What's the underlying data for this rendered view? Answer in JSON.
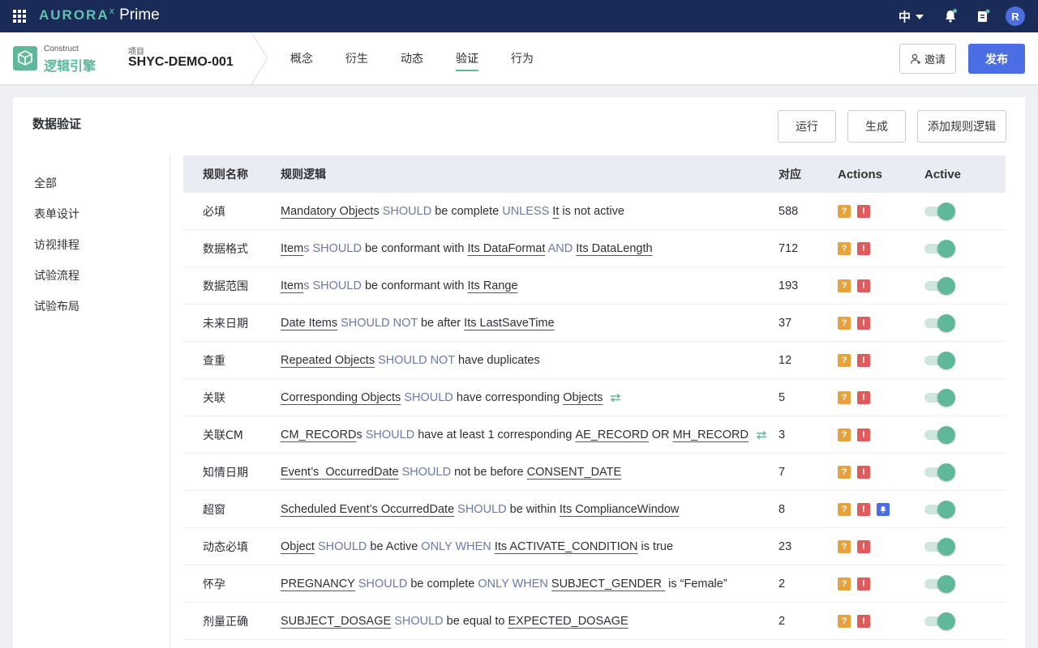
{
  "topbar": {
    "brand_aurora": "AURORA",
    "brand_x": "x",
    "brand_prime": "Prime",
    "language": "中",
    "avatar_initial": "R",
    "icons": [
      "apps-grid-icon",
      "bell-icon",
      "clipboard-icon"
    ]
  },
  "subheader": {
    "module_label": "Construct",
    "module_name": "逻辑引擎",
    "project_label": "项目",
    "project_id": "SHYC-DEMO-001",
    "tabs": [
      {
        "label": "概念"
      },
      {
        "label": "衍生"
      },
      {
        "label": "动态"
      },
      {
        "label": "验证",
        "active": true
      },
      {
        "label": "行为"
      }
    ],
    "invite_label": "邀请",
    "publish_label": "发布"
  },
  "panel": {
    "title": "数据验证",
    "buttons": {
      "run": "运行",
      "generate": "生成",
      "add_rule": "添加规则逻辑"
    },
    "side_menu": [
      "全部",
      "表单设计",
      "访视排程",
      "试验流程",
      "试验布局"
    ]
  },
  "table": {
    "headers": {
      "name": "规则名称",
      "logic": "规则逻辑",
      "count": "对应",
      "actions": "Actions",
      "active": "Active"
    },
    "rows": [
      {
        "name": "必填",
        "logic": [
          [
            "Mandatory Object",
            "u"
          ],
          [
            "s",
            ""
          ],
          [
            " SHOULD ",
            "kw"
          ],
          [
            "be complete ",
            ""
          ],
          [
            "UNLESS ",
            "kw"
          ],
          [
            "It",
            "u"
          ],
          [
            " is not active",
            ""
          ]
        ],
        "count": "588",
        "extra": [],
        "active": true
      },
      {
        "name": "数据格式",
        "logic": [
          [
            "Item",
            "u"
          ],
          [
            "s SHOULD ",
            "kw"
          ],
          [
            "be conformant with ",
            ""
          ],
          [
            "Its DataFormat",
            "u"
          ],
          [
            " AND ",
            "kw"
          ],
          [
            "Its DataLength",
            "u"
          ]
        ],
        "count": "712",
        "extra": [],
        "active": true
      },
      {
        "name": "数据范围",
        "logic": [
          [
            "Item",
            "u"
          ],
          [
            "s SHOULD ",
            "kw"
          ],
          [
            "be conformant with ",
            ""
          ],
          [
            "Its Range",
            "u"
          ]
        ],
        "count": "193",
        "extra": [],
        "active": true
      },
      {
        "name": "未来日期",
        "logic": [
          [
            "Date Items",
            "u"
          ],
          [
            " SHOULD NOT ",
            "kw"
          ],
          [
            "be after ",
            ""
          ],
          [
            "Its LastSaveTime",
            "u"
          ]
        ],
        "count": "37",
        "extra": [],
        "active": true
      },
      {
        "name": "查重",
        "logic": [
          [
            "Repeated Objects",
            "u"
          ],
          [
            " SHOULD NOT ",
            "kw"
          ],
          [
            "have duplicates",
            ""
          ]
        ],
        "count": "12",
        "extra": [],
        "active": true
      },
      {
        "name": "关联",
        "logic": [
          [
            "Corresponding Objects",
            "u"
          ],
          [
            " SHOULD ",
            "kw"
          ],
          [
            "have corresponding ",
            ""
          ],
          [
            "Objects",
            "u"
          ]
        ],
        "link": true,
        "count": "5",
        "extra": [],
        "active": true
      },
      {
        "name": "关联CM",
        "logic": [
          [
            "CM_RECORD",
            "u"
          ],
          [
            "s",
            ""
          ],
          [
            " SHOULD ",
            "kw"
          ],
          [
            "have at least 1 corresponding ",
            ""
          ],
          [
            "AE_RECORD",
            "u"
          ],
          [
            " OR ",
            ""
          ],
          [
            "MH_RECORD",
            "u"
          ]
        ],
        "link": true,
        "count": "3",
        "extra": [],
        "active": true
      },
      {
        "name": "知情日期",
        "logic": [
          [
            "Event’s  OccurredDate",
            "u"
          ],
          [
            " SHOULD ",
            "kw"
          ],
          [
            "not be before ",
            ""
          ],
          [
            "CONSENT_DATE",
            "u"
          ]
        ],
        "count": "7",
        "extra": [],
        "active": true
      },
      {
        "name": "超窗",
        "logic": [
          [
            "Scheduled Event’s OccurredDate",
            "u"
          ],
          [
            " SHOULD ",
            "kw"
          ],
          [
            "be within ",
            ""
          ],
          [
            "Its ComplianceWindow",
            "u"
          ]
        ],
        "count": "8",
        "extra": [
          "bell"
        ],
        "active": true
      },
      {
        "name": "动态必填",
        "logic": [
          [
            "Object",
            "u"
          ],
          [
            " SHOULD ",
            "kw"
          ],
          [
            "be Active ",
            ""
          ],
          [
            "ONLY WHEN ",
            "kw"
          ],
          [
            "Its ACTIVATE_CONDITION",
            "u"
          ],
          [
            " is true",
            ""
          ]
        ],
        "count": "23",
        "extra": [],
        "active": true
      },
      {
        "name": "怀孕",
        "logic": [
          [
            "PREGNANCY",
            "u"
          ],
          [
            " SHOULD ",
            "kw"
          ],
          [
            "be complete ",
            ""
          ],
          [
            "ONLY WHEN ",
            "kw"
          ],
          [
            "SUBJECT_GENDER ",
            "u"
          ],
          [
            " is “Female”",
            ""
          ]
        ],
        "count": "2",
        "extra": [],
        "active": true
      },
      {
        "name": "剂量正确",
        "logic": [
          [
            "SUBJECT_DOSAGE",
            "u"
          ],
          [
            " SHOULD ",
            "kw"
          ],
          [
            "be equal to ",
            ""
          ],
          [
            "EXPECTED_DOSAGE",
            "u"
          ]
        ],
        "count": "2",
        "extra": [],
        "active": true
      }
    ],
    "action_badges": {
      "question": "?",
      "error": "!"
    }
  },
  "colors": {
    "topbar": "#1a2b57",
    "accent_green": "#5fb89a",
    "primary_blue": "#4c6ee4",
    "keyword": "#6a7aa6",
    "warn": "#e8a23d",
    "error": "#e05b5b"
  }
}
